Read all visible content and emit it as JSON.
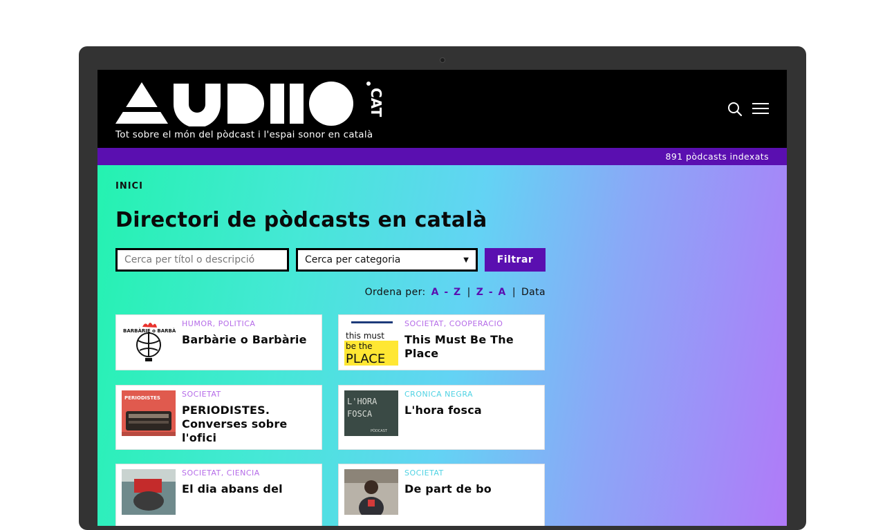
{
  "header": {
    "logo_text": "AUDIO.CAT",
    "tagline": "Tot sobre el món del pòdcast i l'espai sonor en català"
  },
  "info_bar": {
    "count_text": "891 pòdcasts indexats"
  },
  "breadcrumb": {
    "home": "INICI"
  },
  "page": {
    "title": "Directori de pòdcasts en català"
  },
  "filters": {
    "search_placeholder": "Cerca per títol o descripció",
    "category_selected": "Cerca per categoria",
    "filter_label": "Filtrar"
  },
  "sort": {
    "label": "Ordena per:",
    "options": [
      "A - Z",
      "Z - A",
      "Data"
    ],
    "separator": "|"
  },
  "cards": [
    {
      "categories": "HUMOR, POLITICA",
      "title": "Barbàrie o Barbàrie"
    },
    {
      "categories": "SOCIETAT, COOPERACIO",
      "title": "This Must Be The Place"
    },
    {
      "categories": "SOCIETAT",
      "title": "PERIODISTES. Converses sobre l'ofici"
    },
    {
      "categories": "CRONICA NEGRA",
      "title": "L'hora fosca"
    },
    {
      "categories": "SOCIETAT, CIENCIA",
      "title": "El dia abans del"
    },
    {
      "categories": "SOCIETAT",
      "title": "De part de bo"
    }
  ],
  "thumbs": {
    "barbarie_text": "BARBÀRIE o BARBÀRIE",
    "place_text": [
      "this must",
      "be the",
      "PLACE"
    ],
    "periodistes_text": "PERIODISTES",
    "hora_text": [
      "L'HORA",
      "FOSCA"
    ],
    "hora_sub": "PÒDCAST"
  },
  "colors": {
    "accent": "#5a0fb0",
    "category_text": "#b56be8",
    "category_alt": "#4fd2e3"
  }
}
